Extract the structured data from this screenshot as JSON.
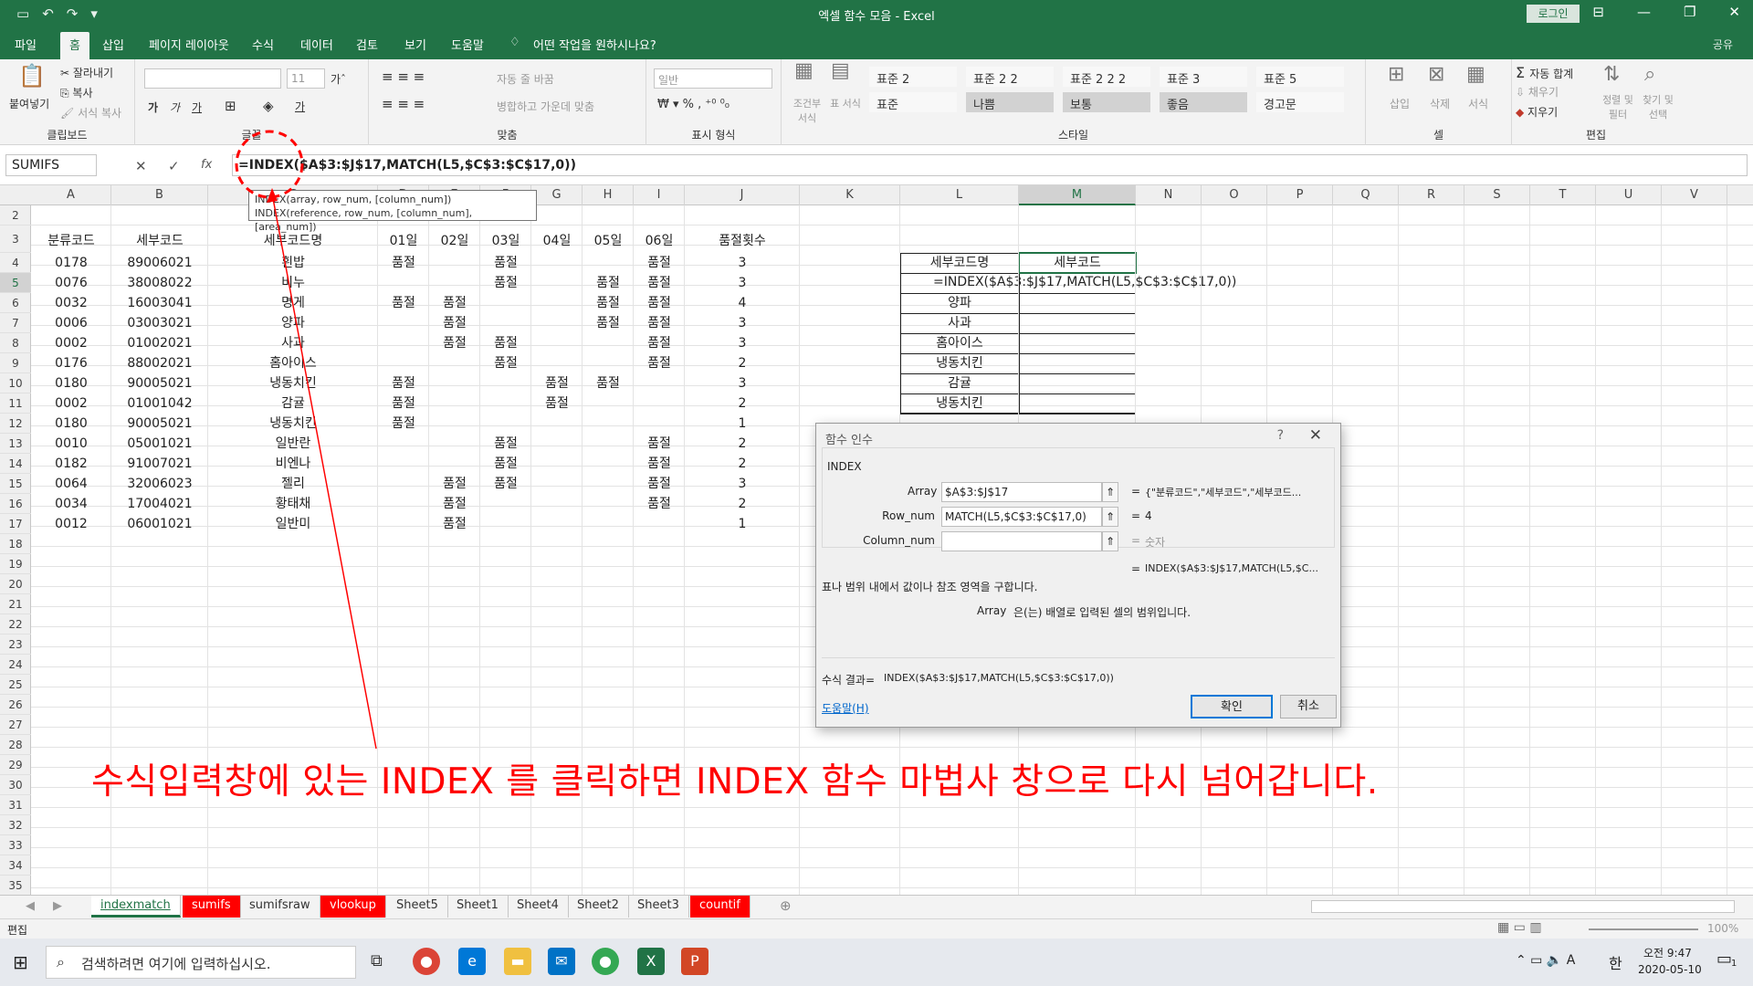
{
  "titlebar": {
    "title": "엑셀 함수 모음 - Excel",
    "login": "로그인"
  },
  "tabs": [
    "파일",
    "홈",
    "삽입",
    "페이지 레이아웃",
    "수식",
    "데이터",
    "검토",
    "보기",
    "도움말",
    "어떤 작업을 원하시나요?"
  ],
  "share": "공유",
  "ribbon": {
    "clipboard": {
      "paste": "붙여넣기",
      "cut": "잘라내기",
      "copy": "복사",
      "format_painter": "서식 복사",
      "label": "클립보드"
    },
    "font": {
      "size": "11",
      "label": "글꼴"
    },
    "align": {
      "wrap": "자동 줄 바꿈",
      "merge": "병합하고 가운데 맞춤",
      "label": "맞춤"
    },
    "number": {
      "format": "일반",
      "label": "표시 형식"
    },
    "styles": {
      "cond": "조건부 서식",
      "table": "표 서식",
      "cells": [
        "표준 2",
        "표준 2 2",
        "표준 2 2 2",
        "표준 3",
        "표준 5",
        "표준",
        "나쁨",
        "보통",
        "좋음",
        "경고문"
      ],
      "label": "스타일"
    },
    "cells": {
      "insert": "삽입",
      "delete": "삭제",
      "format": "서식",
      "label": "셀"
    },
    "edit": {
      "autosum": "자동 합계",
      "fill": "채우기",
      "clear": "지우기",
      "sort": "정렬 및 필터",
      "find": "찾기 및 선택",
      "label": "편집"
    }
  },
  "formulabar": {
    "namebox": "SUMIFS",
    "formula": "=INDEX($A$3:$J$17,MATCH(L5,$C$3:$C$17,0))"
  },
  "tooltip": {
    "line1": "INDEX(array, row_num, [column_num])",
    "line2": "INDEX(reference, row_num, [column_num], [area_num])"
  },
  "columns": [
    "A",
    "B",
    "C",
    "D",
    "E",
    "F",
    "G",
    "H",
    "I",
    "J",
    "K",
    "L",
    "M",
    "N",
    "O",
    "P",
    "Q",
    "R",
    "S",
    "T",
    "U",
    "V"
  ],
  "rows": [
    "2",
    "3",
    "4",
    "5",
    "6",
    "7",
    "8",
    "9",
    "10",
    "11",
    "12",
    "13",
    "14",
    "15",
    "16",
    "17",
    "18",
    "19",
    "20",
    "21",
    "22",
    "23",
    "24",
    "25",
    "26",
    "27",
    "28",
    "29",
    "30",
    "31",
    "32",
    "33",
    "34",
    "35"
  ],
  "table": {
    "header": [
      "분류코드",
      "세부코드",
      "세부코드명",
      "01일",
      "02일",
      "03일",
      "04일",
      "05일",
      "06일",
      "품절횟수"
    ],
    "rows": [
      [
        "0178",
        "89006021",
        "흰밥",
        "품절",
        "",
        "품절",
        "",
        "",
        "품절",
        "3"
      ],
      [
        "0076",
        "38008022",
        "비누",
        "",
        "",
        "품절",
        "",
        "품절",
        "품절",
        "3"
      ],
      [
        "0032",
        "16003041",
        "명게",
        "품절",
        "품절",
        "",
        "",
        "품절",
        "품절",
        "4"
      ],
      [
        "0006",
        "03003021",
        "양파",
        "",
        "품절",
        "",
        "",
        "품절",
        "품절",
        "3"
      ],
      [
        "0002",
        "01002021",
        "사과",
        "",
        "품절",
        "품절",
        "",
        "",
        "품절",
        "3"
      ],
      [
        "0176",
        "88002021",
        "홈아이스",
        "",
        "",
        "품절",
        "",
        "",
        "품절",
        "2"
      ],
      [
        "0180",
        "90005021",
        "냉동치킨",
        "품절",
        "",
        "",
        "품절",
        "품절",
        "",
        "3"
      ],
      [
        "0002",
        "01001042",
        "감귤",
        "품절",
        "",
        "",
        "품절",
        "",
        "",
        "2"
      ],
      [
        "0180",
        "90005021",
        "냉동치킨",
        "품절",
        "",
        "",
        "",
        "",
        "",
        "1"
      ],
      [
        "0010",
        "05001021",
        "일반란",
        "",
        "",
        "품절",
        "",
        "",
        "품절",
        "2"
      ],
      [
        "0182",
        "91007021",
        "비엔나",
        "",
        "",
        "품절",
        "",
        "",
        "품절",
        "2"
      ],
      [
        "0064",
        "32006023",
        "젤리",
        "",
        "품절",
        "품절",
        "",
        "",
        "품절",
        "3"
      ],
      [
        "0034",
        "17004021",
        "황태채",
        "",
        "품절",
        "",
        "",
        "",
        "품절",
        "2"
      ],
      [
        "0012",
        "06001021",
        "일반미",
        "",
        "품절",
        "",
        "",
        "",
        "",
        "1"
      ]
    ]
  },
  "lookup": {
    "h1": "세부코드명",
    "h2": "세부코드",
    "formula": "=INDEX($A$3:$J$17,MATCH(L5,$C$3:$C$17,0))",
    "items": [
      "양파",
      "사과",
      "홈아이스",
      "냉동치킨",
      "감귤",
      "냉동치킨"
    ]
  },
  "dialog": {
    "title": "함수 인수",
    "func": "INDEX",
    "array_label": "Array",
    "array_value": "$A$3:$J$17",
    "array_result": "{\"분류코드\",\"세부코드\",\"세부코드...",
    "row_label": "Row_num",
    "row_value": "MATCH(L5,$C$3:$C$17,0)",
    "row_result": "4",
    "col_label": "Column_num",
    "col_value": "",
    "col_result": "숫자",
    "overall": "INDEX($A$3:$J$17,MATCH(L5,$C...",
    "desc": "표나 범위 내에서 값이나 참조 영역을 구합니다.",
    "arg_name": "Array",
    "arg_desc": "은(는) 배열로 입력된 셀의 범위입니다.",
    "result_label": "수식 결과=",
    "result": "INDEX($A$3:$J$17,MATCH(L5,$C$3:$C$17,0))",
    "help": "도움말(H)",
    "ok": "확인",
    "cancel": "취소"
  },
  "annotation": "수식입력창에 있는 INDEX 를 클릭하면 INDEX 함수 마법사 창으로 다시 넘어갑니다.",
  "sheets": [
    "indexmatch",
    "sumifs",
    "sumifsraw",
    "vlookup",
    "Sheet5",
    "Sheet1",
    "Sheet4",
    "Sheet2",
    "Sheet3",
    "countif"
  ],
  "status": {
    "mode": "편집",
    "zoom": "100%"
  },
  "taskbar": {
    "search": "검색하려면 여기에 입력하십시오.",
    "time": "오전 9:47",
    "date": "2020-05-10",
    "ime": "한",
    "notif": "1"
  },
  "colors": {
    "excel_green": "#217346",
    "annotation_red": "#ff0000"
  }
}
